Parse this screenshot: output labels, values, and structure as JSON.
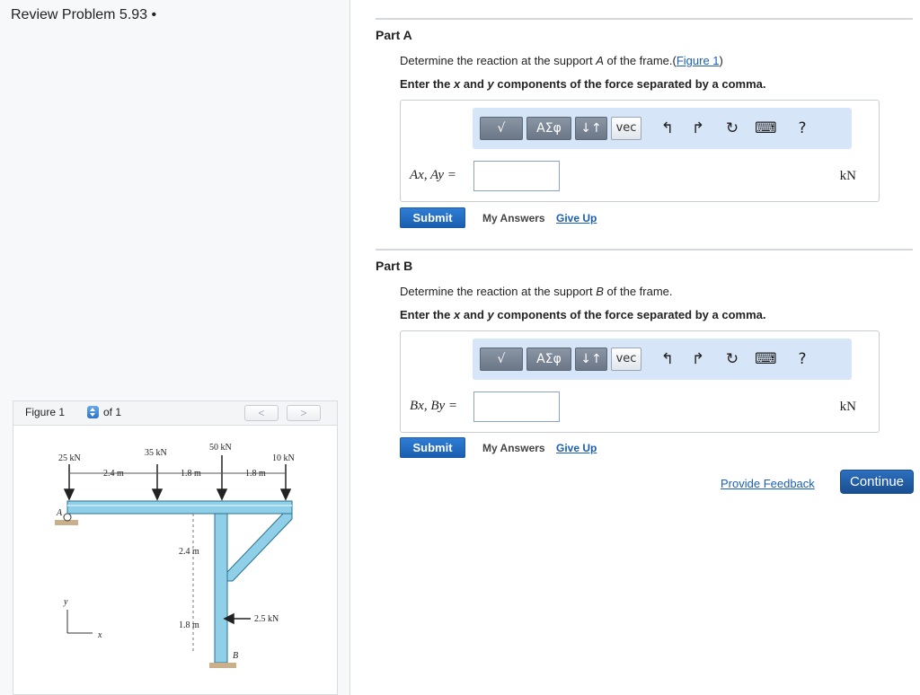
{
  "page": {
    "title": "Review Problem 5.93 •"
  },
  "figure_panel": {
    "label": "Figure 1",
    "of_text": "of 1",
    "prev_label": "<",
    "next_label": ">",
    "loads": [
      "25 kN",
      "35 kN",
      "50 kN",
      "10 kN"
    ],
    "horizontal_dims": [
      "2.4 m",
      "1.8 m",
      "1.8 m"
    ],
    "vertical_dims": [
      "2.4 m",
      "1.8 m"
    ],
    "side_load": "2.5 kN",
    "support_a": "A",
    "support_b": "B",
    "axis_x": "x",
    "axis_y": "y"
  },
  "toolbar": {
    "template_symbol": "√",
    "greek_label": "ΑΣφ",
    "arrows_label": "↓↑",
    "vec_label": "vec",
    "help_label": "?"
  },
  "part_a": {
    "title": "Part A",
    "prompt_before": "Determine the reaction at the support ",
    "prompt_var": "A",
    "prompt_after": " of the frame.(",
    "figure_link": "Figure 1",
    "prompt_close": ")",
    "instruction_before": "Enter the ",
    "instr_x": "x",
    "instruction_mid": " and ",
    "instr_y": "y",
    "instruction_after": " components of the force separated by a comma.",
    "answer_label": "Ax, Ay =",
    "answer_value": "",
    "unit": "kN",
    "submit": "Submit",
    "my_answers": "My Answers",
    "give_up": "Give Up"
  },
  "part_b": {
    "title": "Part B",
    "prompt_before": "Determine the reaction at the support ",
    "prompt_var": "B",
    "prompt_after": " of the frame.",
    "instruction_before": "Enter the ",
    "instr_x": "x",
    "instruction_mid": " and ",
    "instr_y": "y",
    "instruction_after": " components of the force separated by a comma.",
    "answer_label": "Bx, By =",
    "answer_value": "",
    "unit": "kN",
    "submit": "Submit",
    "my_answers": "My Answers",
    "give_up": "Give Up"
  },
  "footer": {
    "feedback": "Provide Feedback",
    "continue": "Continue"
  }
}
